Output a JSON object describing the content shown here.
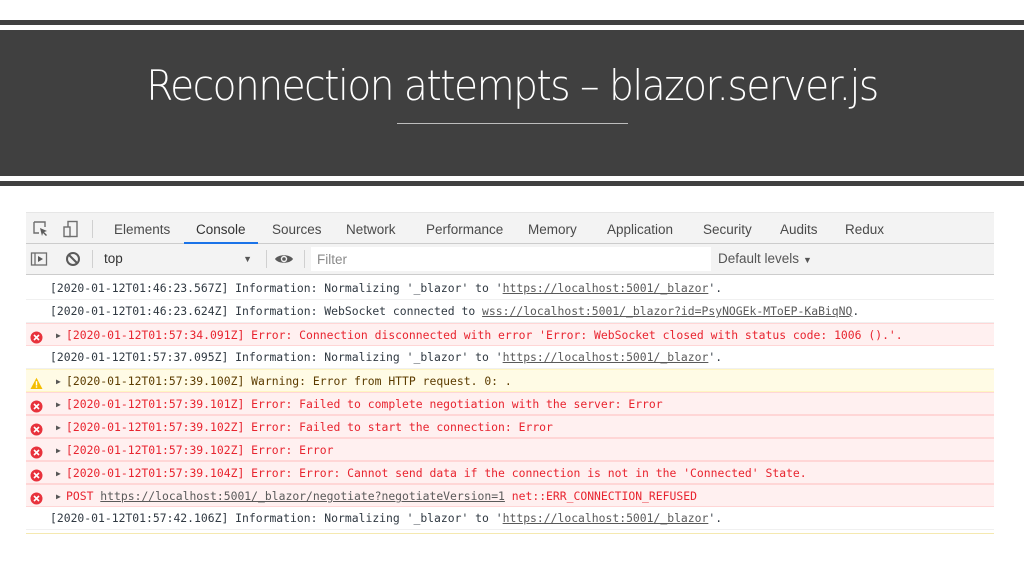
{
  "slide": {
    "title": "Reconnection attempts – blazor.server.js"
  },
  "devtools": {
    "toolbar_icons": [
      "inspect-element-icon",
      "device-toolbar-icon"
    ],
    "tabs": [
      {
        "label": "Elements",
        "active": false
      },
      {
        "label": "Console",
        "active": true
      },
      {
        "label": "Sources",
        "active": false
      },
      {
        "label": "Network",
        "active": false
      },
      {
        "label": "Performance",
        "active": false
      },
      {
        "label": "Memory",
        "active": false
      },
      {
        "label": "Application",
        "active": false
      },
      {
        "label": "Security",
        "active": false
      },
      {
        "label": "Audits",
        "active": false
      },
      {
        "label": "Redux",
        "active": false
      }
    ],
    "console_bar": {
      "sidebar_toggle_icon": "show-sidebar-icon",
      "clear_icon": "clear-console-icon",
      "context": "top",
      "eye_icon": "live-expression-icon",
      "filter_placeholder": "Filter",
      "filter_value": "",
      "levels": "Default levels"
    },
    "colors": {
      "error_text": "#e8242f",
      "error_bg": "#fff0f0",
      "warning_bg": "#fffbe5",
      "warning_text": "#5c3c00",
      "active_tab_underline": "#1a73e8",
      "banner_bg": "#404040"
    },
    "messages": [
      {
        "level": "info",
        "expandable": false,
        "prefix": "[2020-01-12T01:46:23.567Z] Information: Normalizing '_blazor' to '",
        "link": "https://localhost:5001/_blazor",
        "suffix": "'."
      },
      {
        "level": "info",
        "expandable": false,
        "prefix": "[2020-01-12T01:46:23.624Z] Information: WebSocket connected to ",
        "link": "wss://localhost:5001/_blazor?id=PsyNOGEk-MToEP-KaBiqNQ",
        "suffix": "."
      },
      {
        "level": "error",
        "expandable": true,
        "prefix": "[2020-01-12T01:57:34.091Z] Error: Connection disconnected with error 'Error: WebSocket closed with status code: 1006 ().'.",
        "link": "",
        "suffix": ""
      },
      {
        "level": "info",
        "expandable": false,
        "prefix": "[2020-01-12T01:57:37.095Z] Information: Normalizing '_blazor' to '",
        "link": "https://localhost:5001/_blazor",
        "suffix": "'."
      },
      {
        "level": "warning",
        "expandable": true,
        "prefix": "[2020-01-12T01:57:39.100Z] Warning: Error from HTTP request. 0: .",
        "link": "",
        "suffix": ""
      },
      {
        "level": "error",
        "expandable": true,
        "prefix": "[2020-01-12T01:57:39.101Z] Error: Failed to complete negotiation with the server: Error",
        "link": "",
        "suffix": ""
      },
      {
        "level": "error",
        "expandable": true,
        "prefix": "[2020-01-12T01:57:39.102Z] Error: Failed to start the connection: Error",
        "link": "",
        "suffix": ""
      },
      {
        "level": "error",
        "expandable": true,
        "prefix": "[2020-01-12T01:57:39.102Z] Error: Error",
        "link": "",
        "suffix": ""
      },
      {
        "level": "error",
        "expandable": true,
        "prefix": "[2020-01-12T01:57:39.104Z] Error: Error: Cannot send data if the connection is not in the 'Connected' State.",
        "link": "",
        "suffix": ""
      },
      {
        "level": "error",
        "expandable": true,
        "prefix": "POST ",
        "link": "https://localhost:5001/_blazor/negotiate?negotiateVersion=1",
        "suffix": " net::ERR_CONNECTION_REFUSED"
      },
      {
        "level": "info",
        "expandable": false,
        "prefix": "[2020-01-12T01:57:42.106Z] Information: Normalizing '_blazor' to '",
        "link": "https://localhost:5001/_blazor",
        "suffix": "'."
      }
    ]
  }
}
